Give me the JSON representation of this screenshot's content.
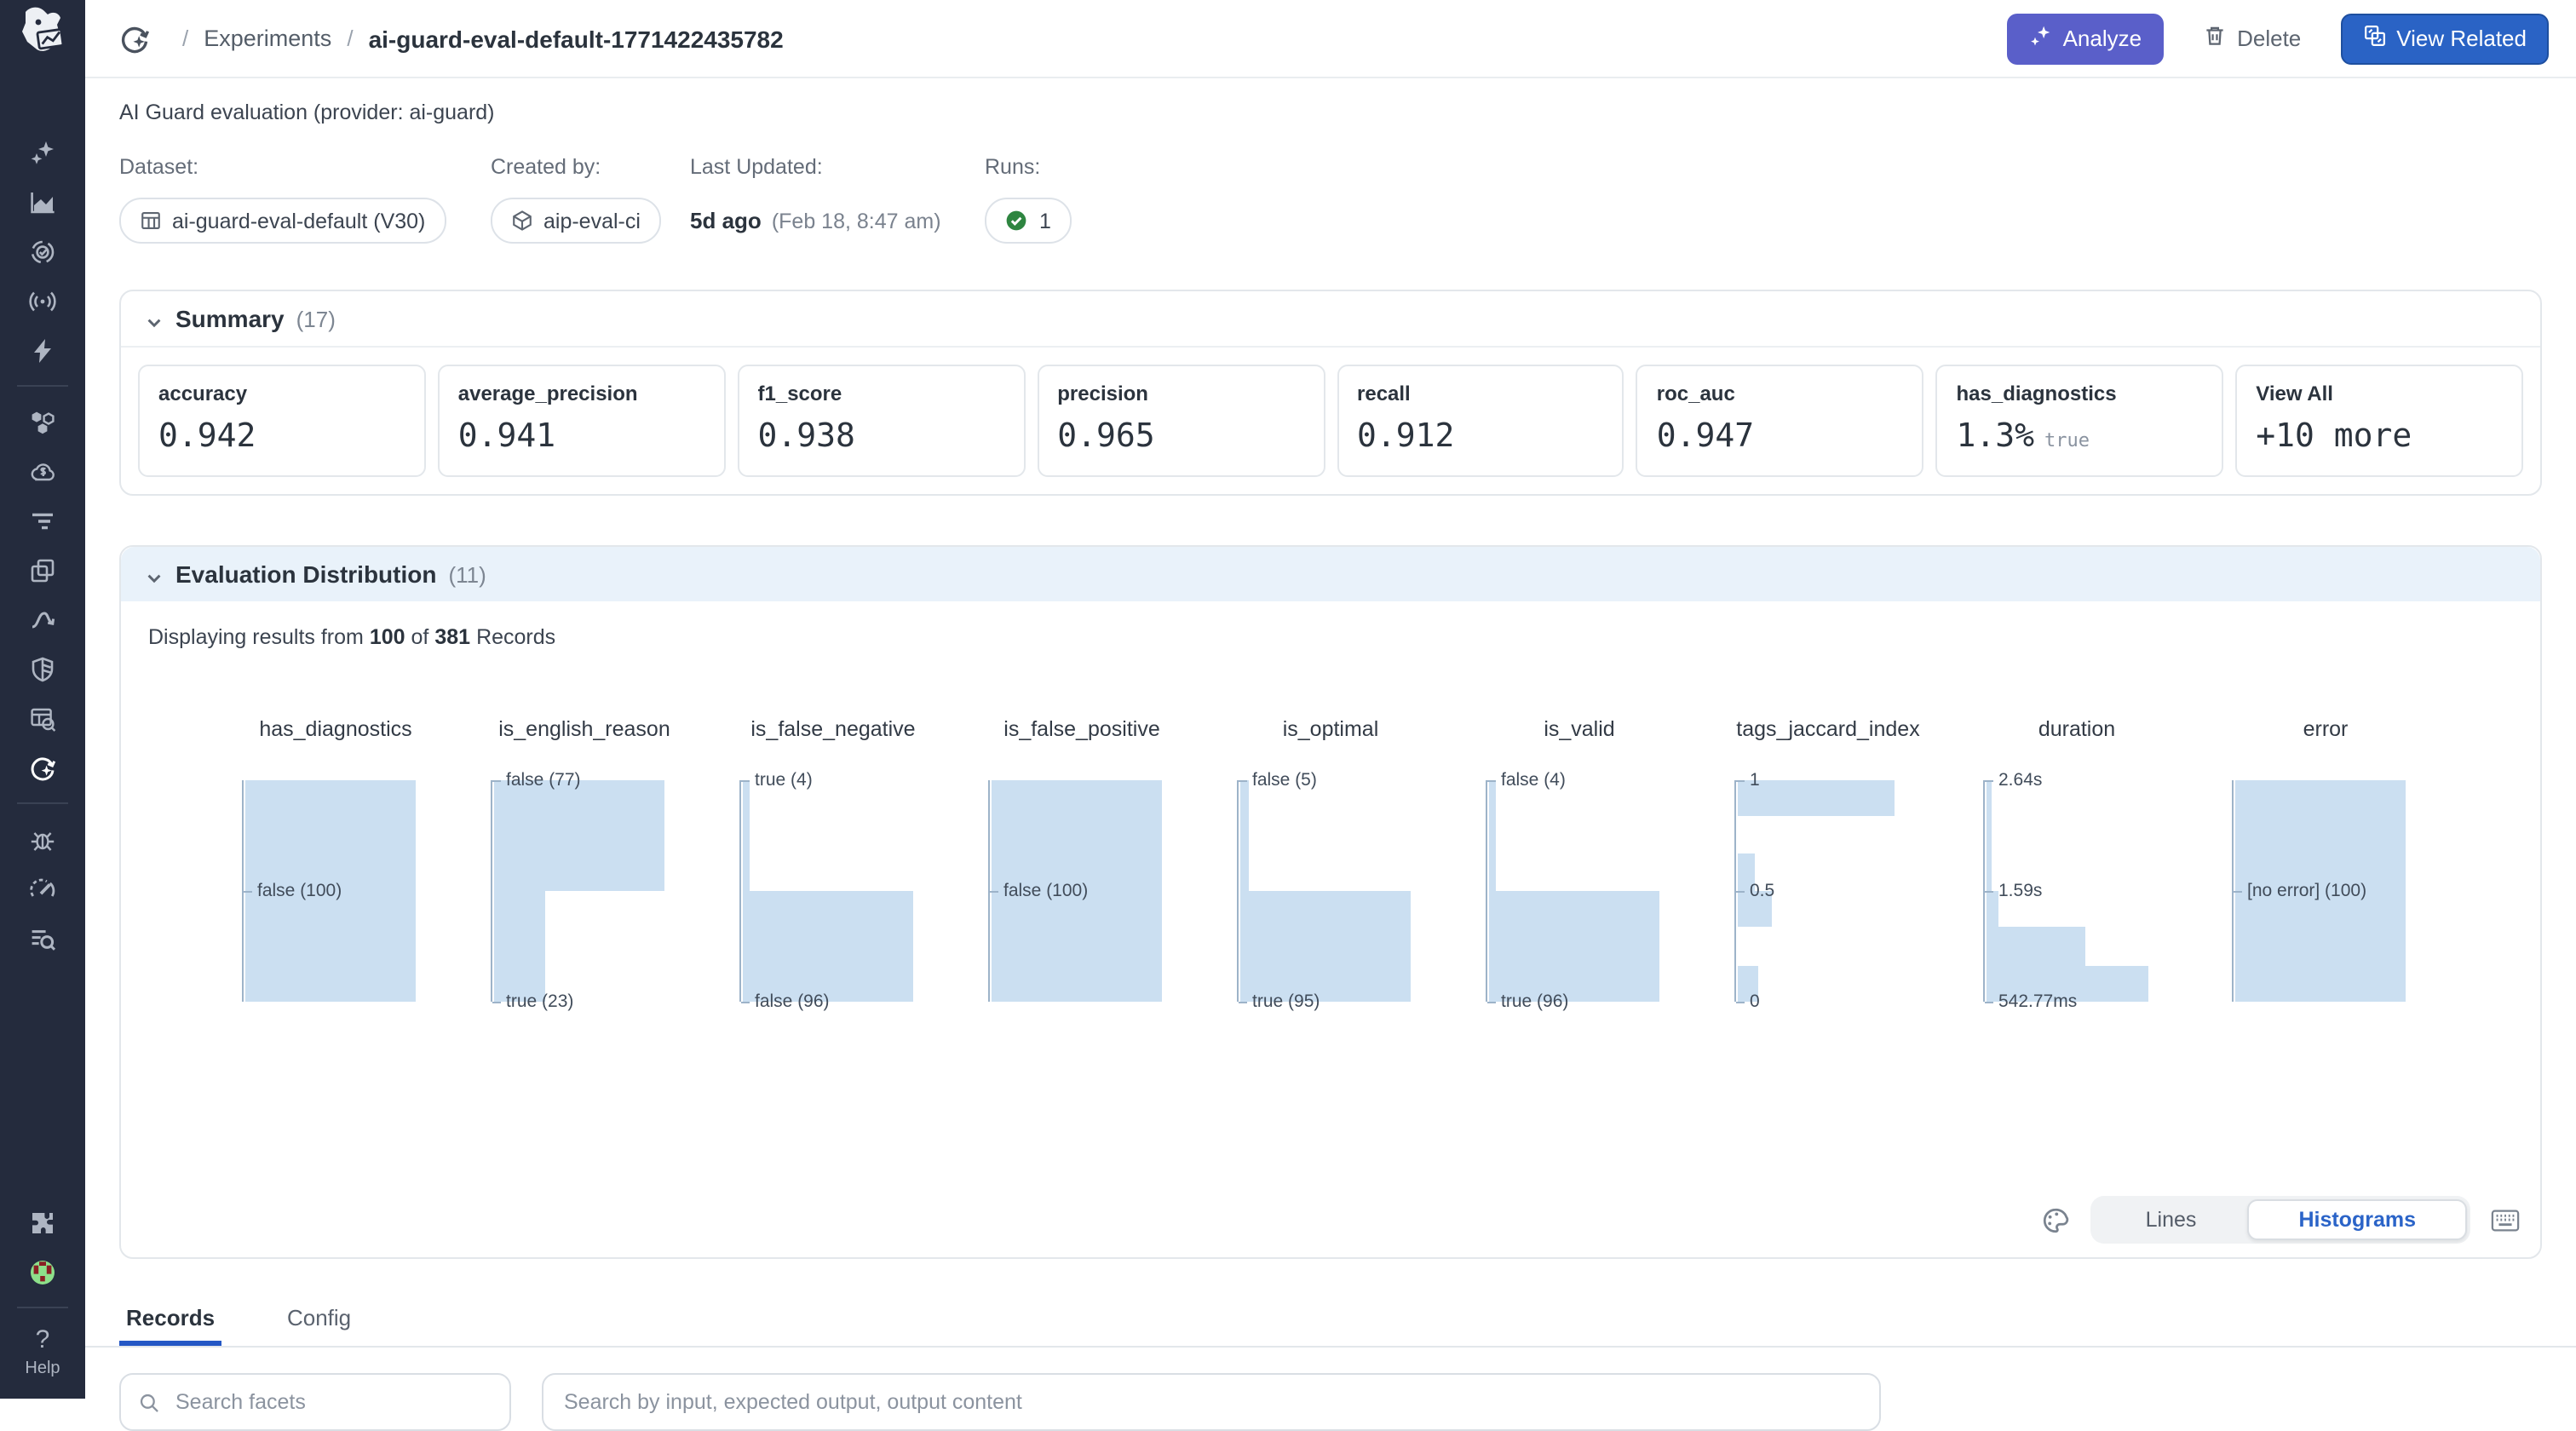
{
  "colors": {
    "sidebar_bg": "#242b3d",
    "analyze_accent": "#5a5fc9",
    "primary_blue": "#2a63c5",
    "eval_header_bg": "#e9f2fa",
    "bar_fill": "#cbdff1",
    "axis": "#9db3c9",
    "success_green": "#2e8540",
    "tab_underline": "#2457c5"
  },
  "sidebar": {
    "logo": "datadog-logo",
    "items": [
      {
        "name": "ai-sparkles",
        "icon": "sparkles"
      },
      {
        "name": "metrics",
        "icon": "areachart"
      },
      {
        "name": "watchdog",
        "icon": "target"
      },
      {
        "name": "monitoring-radar",
        "icon": "radar"
      },
      {
        "name": "powerpacks",
        "icon": "bolt"
      },
      {
        "name": "divider"
      },
      {
        "name": "infrastructure",
        "icon": "hexes"
      },
      {
        "name": "cloud-cost",
        "icon": "cloudd"
      },
      {
        "name": "apm-traces",
        "icon": "funnel"
      },
      {
        "name": "service-windows",
        "icon": "windows"
      },
      {
        "name": "pipelines",
        "icon": "curve"
      },
      {
        "name": "security",
        "icon": "shield"
      },
      {
        "name": "data-search",
        "icon": "tablesearch"
      },
      {
        "name": "llm-observability",
        "icon": "llmobs",
        "active": true
      },
      {
        "name": "divider"
      },
      {
        "name": "error-tracking",
        "icon": "bug"
      },
      {
        "name": "performance-gauge",
        "icon": "gauge"
      },
      {
        "name": "log-explorer",
        "icon": "logsearch"
      }
    ],
    "bottom": [
      {
        "name": "integrations",
        "icon": "puzzle"
      },
      {
        "name": "user-avatar",
        "icon": "avatar"
      },
      {
        "name": "divider"
      },
      {
        "name": "help",
        "icon": "help",
        "label": "Help"
      }
    ]
  },
  "header": {
    "breadcrumb": {
      "separator": "/",
      "section": "Experiments",
      "title": "ai-guard-eval-default-1771422435782"
    },
    "actions": {
      "analyze": "Analyze",
      "delete": "Delete",
      "view_related": "View Related"
    }
  },
  "meta": {
    "description": "AI Guard evaluation (provider: ai-guard)",
    "dataset": {
      "label": "Dataset:",
      "value": "ai-guard-eval-default (V30)"
    },
    "created_by": {
      "label": "Created by:",
      "value": "aip-eval-ci"
    },
    "last_updated": {
      "label": "Last Updated:",
      "relative": "5d ago",
      "absolute": "(Feb 18, 8:47 am)"
    },
    "runs": {
      "label": "Runs:",
      "count": "1"
    }
  },
  "summary": {
    "title": "Summary",
    "count": "(17)",
    "cards": [
      {
        "label": "accuracy",
        "value": "0.942"
      },
      {
        "label": "average_precision",
        "value": "0.941"
      },
      {
        "label": "f1_score",
        "value": "0.938"
      },
      {
        "label": "precision",
        "value": "0.965"
      },
      {
        "label": "recall",
        "value": "0.912"
      },
      {
        "label": "roc_auc",
        "value": "0.947"
      },
      {
        "label": "has_diagnostics",
        "value": "1.3%",
        "suffix": "true"
      },
      {
        "label": "View All",
        "value": "+10 more",
        "view_all": true
      }
    ]
  },
  "evaluation": {
    "title": "Evaluation Distribution",
    "count": "(11)",
    "records_line": {
      "prefix": "Displaying results from",
      "shown": "100",
      "middle": "of",
      "total": "381",
      "suffix": "Records"
    },
    "controls": {
      "lines": "Lines",
      "histograms": "Histograms",
      "active": "Histograms"
    },
    "charts": [
      {
        "name": "has_diagnostics",
        "type": "categorical",
        "bars": [
          {
            "label": "false",
            "count": 100,
            "y0": 0,
            "y1": 1,
            "frac": 1
          }
        ],
        "labels": [
          {
            "text": "false (100)",
            "y": 0.5
          }
        ]
      },
      {
        "name": "is_english_reason",
        "type": "categorical",
        "bars": [
          {
            "label": "false",
            "count": 77,
            "y0": 0,
            "y1": 0.5,
            "frac": 1
          },
          {
            "label": "true",
            "count": 23,
            "y0": 0.5,
            "y1": 1,
            "frac": 0.3
          }
        ],
        "labels": [
          {
            "text": "false (77)",
            "y": 0
          },
          {
            "text": "true (23)",
            "y": 1
          }
        ]
      },
      {
        "name": "is_false_negative",
        "type": "categorical",
        "bars": [
          {
            "label": "true",
            "count": 4,
            "y0": 0,
            "y1": 0.5,
            "frac": 0.042
          },
          {
            "label": "false",
            "count": 96,
            "y0": 0.5,
            "y1": 1,
            "frac": 1
          }
        ],
        "labels": [
          {
            "text": "true (4)",
            "y": 0
          },
          {
            "text": "false (96)",
            "y": 1
          }
        ]
      },
      {
        "name": "is_false_positive",
        "type": "categorical",
        "bars": [
          {
            "label": "false",
            "count": 100,
            "y0": 0,
            "y1": 1,
            "frac": 1
          }
        ],
        "labels": [
          {
            "text": "false (100)",
            "y": 0.5
          }
        ]
      },
      {
        "name": "is_optimal",
        "type": "categorical",
        "bars": [
          {
            "label": "false",
            "count": 5,
            "y0": 0,
            "y1": 0.5,
            "frac": 0.053
          },
          {
            "label": "true",
            "count": 95,
            "y0": 0.5,
            "y1": 1,
            "frac": 1
          }
        ],
        "labels": [
          {
            "text": "false (5)",
            "y": 0
          },
          {
            "text": "true (95)",
            "y": 1
          }
        ]
      },
      {
        "name": "is_valid",
        "type": "categorical",
        "bars": [
          {
            "label": "false",
            "count": 4,
            "y0": 0,
            "y1": 0.5,
            "frac": 0.042
          },
          {
            "label": "true",
            "count": 96,
            "y0": 0.5,
            "y1": 1,
            "frac": 1
          }
        ],
        "labels": [
          {
            "text": "false (4)",
            "y": 0
          },
          {
            "text": "true (96)",
            "y": 1
          }
        ]
      },
      {
        "name": "tags_jaccard_index",
        "type": "numeric",
        "bars": [
          {
            "y0": 0,
            "y1": 0.165,
            "frac": 0.92
          },
          {
            "y0": 0.33,
            "y1": 0.5,
            "frac": 0.1
          },
          {
            "y0": 0.5,
            "y1": 0.665,
            "frac": 0.2
          },
          {
            "y0": 0.835,
            "y1": 1,
            "frac": 0.12
          }
        ],
        "labels": [
          {
            "text": "1",
            "y": 0
          },
          {
            "text": "0.5",
            "y": 0.5
          },
          {
            "text": "0",
            "y": 1
          }
        ]
      },
      {
        "name": "duration",
        "type": "numeric",
        "bars": [
          {
            "y0": 0,
            "y1": 0.165,
            "frac": 0.03
          },
          {
            "y0": 0.165,
            "y1": 0.33,
            "frac": 0.03
          },
          {
            "y0": 0.33,
            "y1": 0.5,
            "frac": 0.03
          },
          {
            "y0": 0.5,
            "y1": 0.665,
            "frac": 0.07
          },
          {
            "y0": 0.665,
            "y1": 0.835,
            "frac": 0.58
          },
          {
            "y0": 0.835,
            "y1": 1,
            "frac": 0.95
          }
        ],
        "labels": [
          {
            "text": "2.64s",
            "y": 0
          },
          {
            "text": "1.59s",
            "y": 0.5
          },
          {
            "text": "542.77ms",
            "y": 1
          }
        ]
      },
      {
        "name": "error",
        "type": "categorical",
        "bars": [
          {
            "label": "[no error]",
            "count": 100,
            "y0": 0,
            "y1": 1,
            "frac": 1
          }
        ],
        "labels": [
          {
            "text": "[no error] (100)",
            "y": 0.5
          }
        ]
      }
    ]
  },
  "tabs": {
    "records": "Records",
    "config": "Config",
    "active": "Records"
  },
  "search": {
    "facets_placeholder": "Search facets",
    "records_placeholder": "Search by input, expected output, output content"
  }
}
